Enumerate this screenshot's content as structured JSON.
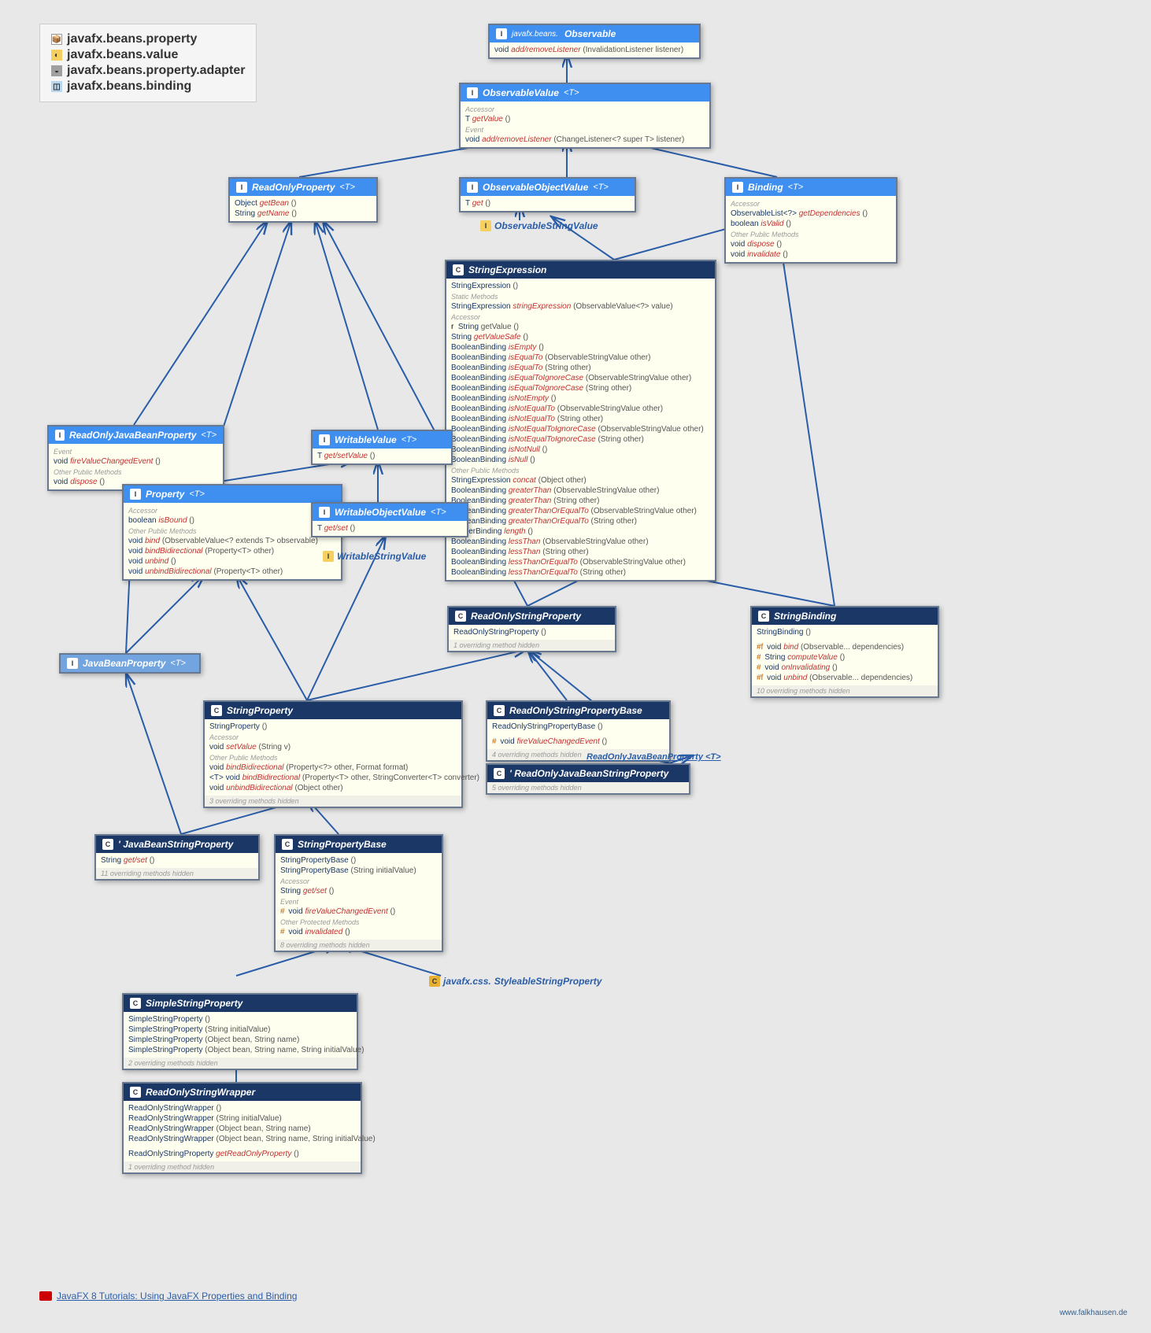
{
  "legend": {
    "items": [
      {
        "text": "javafx.beans.property"
      },
      {
        "text": "javafx.beans.value"
      },
      {
        "text": "javafx.beans.property.adapter"
      },
      {
        "text": "javafx.beans.binding"
      }
    ]
  },
  "floating": {
    "observableStringValue": "ObservableStringValue",
    "writableStringValue": "WritableStringValue",
    "styleableStringProperty": "StyleableStringProperty",
    "styleablePkg": "javafx.css.",
    "readOnlyJavaBeanProperty": "ReadOnlyJavaBeanProperty <T>"
  },
  "observable": {
    "pkg": "javafx.beans.",
    "title": "Observable",
    "m1_ret": "void",
    "m1_name": "add/removeListener",
    "m1_params": "(InvalidationListener listener)"
  },
  "observableValue": {
    "title": "ObservableValue",
    "typeParam": "<T>",
    "sec1": "Accessor",
    "m1_ret": "T",
    "m1_name": "getValue",
    "m1_params": "()",
    "sec2": "Event",
    "m2_ret": "void",
    "m2_name": "add/removeListener",
    "m2_params": "(ChangeListener<? super T> listener)"
  },
  "readOnlyProperty": {
    "title": "ReadOnlyProperty",
    "typeParam": "<T>",
    "m1_ret": "Object",
    "m1_name": "getBean",
    "m1_params": "()",
    "m2_ret": "String",
    "m2_name": "getName",
    "m2_params": "()"
  },
  "observableObjectValue": {
    "title": "ObservableObjectValue",
    "typeParam": "<T>",
    "m1_ret": "T",
    "m1_name": "get",
    "m1_params": "()"
  },
  "binding": {
    "title": "Binding",
    "typeParam": "<T>",
    "sec1": "Accessor",
    "m1_ret": "ObservableList<?>",
    "m1_name": "getDependencies",
    "m1_params": "()",
    "m2_ret": "boolean",
    "m2_name": "isValid",
    "m2_params": "()",
    "sec2": "Other Public Methods",
    "m3_ret": "void",
    "m3_name": "dispose",
    "m3_params": "()",
    "m4_ret": "void",
    "m4_name": "invalidate",
    "m4_params": "()"
  },
  "readOnlyJavaBeanProperty": {
    "title": "ReadOnlyJavaBeanProperty",
    "typeParam": "<T>",
    "sec1": "Event",
    "m1_ret": "void",
    "m1_name": "fireValueChangedEvent",
    "m1_params": "()",
    "sec2": "Other Public Methods",
    "m2_ret": "void",
    "m2_name": "dispose",
    "m2_params": "()"
  },
  "property": {
    "title": "Property",
    "typeParam": "<T>",
    "sec1": "Accessor",
    "m1_ret": "boolean",
    "m1_name": "isBound",
    "m1_params": "()",
    "sec2": "Other Public Methods",
    "m2_ret": "void",
    "m2_name": "bind",
    "m2_params": "(ObservableValue<? extends T> observable)",
    "m3_ret": "void",
    "m3_name": "bindBidirectional",
    "m3_params": "(Property<T> other)",
    "m4_ret": "void",
    "m4_name": "unbind",
    "m4_params": "()",
    "m5_ret": "void",
    "m5_name": "unbindBidirectional",
    "m5_params": "(Property<T> other)"
  },
  "writableValue": {
    "title": "WritableValue",
    "typeParam": "<T>",
    "m1_ret": "T",
    "m1_name": "get/setValue",
    "m1_params": "()"
  },
  "writableObjectValue": {
    "title": "WritableObjectValue",
    "typeParam": "<T>",
    "m1_ret": "T",
    "m1_name": "get/set",
    "m1_params": "()"
  },
  "stringExpression": {
    "title": "StringExpression",
    "ctor": "StringExpression",
    "ctor_params": "()",
    "sec_static": "Static Methods",
    "s1_ret": "StringExpression",
    "s1_name": "stringExpression",
    "s1_params": "(ObservableValue<?> value)",
    "sec_acc": "Accessor",
    "a1_ret": "String",
    "a1_name": "getValue",
    "a1_params": "()",
    "a2_ret": "String",
    "a2_name": "getValueSafe",
    "a2_params": "()",
    "a3_ret": "BooleanBinding",
    "a3_name": "isEmpty",
    "a3_params": "()",
    "a4_ret": "BooleanBinding",
    "a4_name": "isEqualTo",
    "a4_params": "(ObservableStringValue other)",
    "a5_ret": "BooleanBinding",
    "a5_name": "isEqualTo",
    "a5_params": "(String other)",
    "a6_ret": "BooleanBinding",
    "a6_name": "isEqualToIgnoreCase",
    "a6_params": "(ObservableStringValue other)",
    "a7_ret": "BooleanBinding",
    "a7_name": "isEqualToIgnoreCase",
    "a7_params": "(String other)",
    "a8_ret": "BooleanBinding",
    "a8_name": "isNotEmpty",
    "a8_params": "()",
    "a9_ret": "BooleanBinding",
    "a9_name": "isNotEqualTo",
    "a9_params": "(ObservableStringValue other)",
    "a10_ret": "BooleanBinding",
    "a10_name": "isNotEqualTo",
    "a10_params": "(String other)",
    "a11_ret": "BooleanBinding",
    "a11_name": "isNotEqualToIgnoreCase",
    "a11_params": "(ObservableStringValue other)",
    "a12_ret": "BooleanBinding",
    "a12_name": "isNotEqualToIgnoreCase",
    "a12_params": "(String other)",
    "a13_ret": "BooleanBinding",
    "a13_name": "isNotNull",
    "a13_params": "()",
    "a14_ret": "BooleanBinding",
    "a14_name": "isNull",
    "a14_params": "()",
    "sec_pub": "Other Public Methods",
    "p1_ret": "StringExpression",
    "p1_name": "concat",
    "p1_params": "(Object other)",
    "p2_ret": "BooleanBinding",
    "p2_name": "greaterThan",
    "p2_params": "(ObservableStringValue other)",
    "p3_ret": "BooleanBinding",
    "p3_name": "greaterThan",
    "p3_params": "(String other)",
    "p4_ret": "BooleanBinding",
    "p4_name": "greaterThanOrEqualTo",
    "p4_params": "(ObservableStringValue other)",
    "p5_ret": "BooleanBinding",
    "p5_name": "greaterThanOrEqualTo",
    "p5_params": "(String other)",
    "p6_ret": "IntegerBinding",
    "p6_name": "length",
    "p6_params": "()",
    "p7_ret": "BooleanBinding",
    "p7_name": "lessThan",
    "p7_params": "(ObservableStringValue other)",
    "p8_ret": "BooleanBinding",
    "p8_name": "lessThan",
    "p8_params": "(String other)",
    "p9_ret": "BooleanBinding",
    "p9_name": "lessThanOrEqualTo",
    "p9_params": "(ObservableStringValue other)",
    "p10_ret": "BooleanBinding",
    "p10_name": "lessThanOrEqualTo",
    "p10_params": "(String other)"
  },
  "readOnlyStringProperty": {
    "title": "ReadOnlyStringProperty",
    "ctor": "ReadOnlyStringProperty",
    "ctor_params": "()",
    "note": "1 overriding method hidden"
  },
  "stringBinding": {
    "title": "StringBinding",
    "ctor": "StringBinding",
    "ctor_params": "()",
    "m1_mod": "#f",
    "m1_ret": "void",
    "m1_name": "bind",
    "m1_params": "(Observable... dependencies)",
    "m2_mod": "#",
    "m2_ret": "String",
    "m2_name": "computeValue",
    "m2_params": "()",
    "m3_mod": "#",
    "m3_ret": "void",
    "m3_name": "onInvalidating",
    "m3_params": "()",
    "m4_mod": "#f",
    "m4_ret": "void",
    "m4_name": "unbind",
    "m4_params": "(Observable... dependencies)",
    "note": "10 overriding methods hidden"
  },
  "javaBeanProperty": {
    "title": "JavaBeanProperty",
    "typeParam": "<T>"
  },
  "stringProperty": {
    "title": "StringProperty",
    "ctor": "StringProperty",
    "ctor_params": "()",
    "sec1": "Accessor",
    "m1_ret": "void",
    "m1_name": "setValue",
    "m1_params": "(String v)",
    "sec2": "Other Public Methods",
    "m2_ret": "void",
    "m2_name": "bindBidirectional",
    "m2_params": "(Property<?> other, Format format)",
    "m3_ret": "<T> void",
    "m3_name": "bindBidirectional",
    "m3_params": "(Property<T> other, StringConverter<T> converter)",
    "m4_ret": "void",
    "m4_name": "unbindBidirectional",
    "m4_params": "(Object other)",
    "note": "3 overriding methods hidden"
  },
  "readOnlyStringPropertyBase": {
    "title": "ReadOnlyStringPropertyBase",
    "ctor": "ReadOnlyStringPropertyBase",
    "ctor_params": "()",
    "m1_mod": "#",
    "m1_ret": "void",
    "m1_name": "fireValueChangedEvent",
    "m1_params": "()",
    "note": "4 overriding methods hidden"
  },
  "readOnlyJavaBeanStringProperty": {
    "title": "' ReadOnlyJavaBeanStringProperty",
    "note": "5 overriding methods hidden"
  },
  "javaBeanStringProperty": {
    "title": "' JavaBeanStringProperty",
    "m1_ret": "String",
    "m1_name": "get/set",
    "m1_params": "()",
    "note": "11 overriding methods hidden"
  },
  "stringPropertyBase": {
    "title": "StringPropertyBase",
    "ctor1": "StringPropertyBase",
    "ctor1_params": "()",
    "ctor2": "StringPropertyBase",
    "ctor2_params": "(String initialValue)",
    "sec1": "Accessor",
    "m1_ret": "String",
    "m1_name": "get/set",
    "m1_params": "()",
    "sec2": "Event",
    "m2_mod": "#",
    "m2_ret": "void",
    "m2_name": "fireValueChangedEvent",
    "m2_params": "()",
    "sec3": "Other Protected Methods",
    "m3_mod": "#",
    "m3_ret": "void",
    "m3_name": "invalidated",
    "m3_params": "()",
    "note": "8 overriding methods hidden"
  },
  "simpleStringProperty": {
    "title": "SimpleStringProperty",
    "c1": "SimpleStringProperty",
    "c1_params": "()",
    "c2": "SimpleStringProperty",
    "c2_params": "(String initialValue)",
    "c3": "SimpleStringProperty",
    "c3_params": "(Object bean, String name)",
    "c4": "SimpleStringProperty",
    "c4_params": "(Object bean, String name, String initialValue)",
    "note": "2 overriding methods hidden"
  },
  "readOnlyStringWrapper": {
    "title": "ReadOnlyStringWrapper",
    "c1": "ReadOnlyStringWrapper",
    "c1_params": "()",
    "c2": "ReadOnlyStringWrapper",
    "c2_params": "(String initialValue)",
    "c3": "ReadOnlyStringWrapper",
    "c3_params": "(Object bean, String name)",
    "c4": "ReadOnlyStringWrapper",
    "c4_params": "(Object bean, String name, String initialValue)",
    "m1_ret": "ReadOnlyStringProperty",
    "m1_name": "getReadOnlyProperty",
    "m1_params": "()",
    "note": "1 overriding method hidden"
  },
  "footer": {
    "linkText": "JavaFX 8 Tutorials: Using JavaFX Properties and Binding"
  },
  "watermark": "www.falkhausen.de"
}
